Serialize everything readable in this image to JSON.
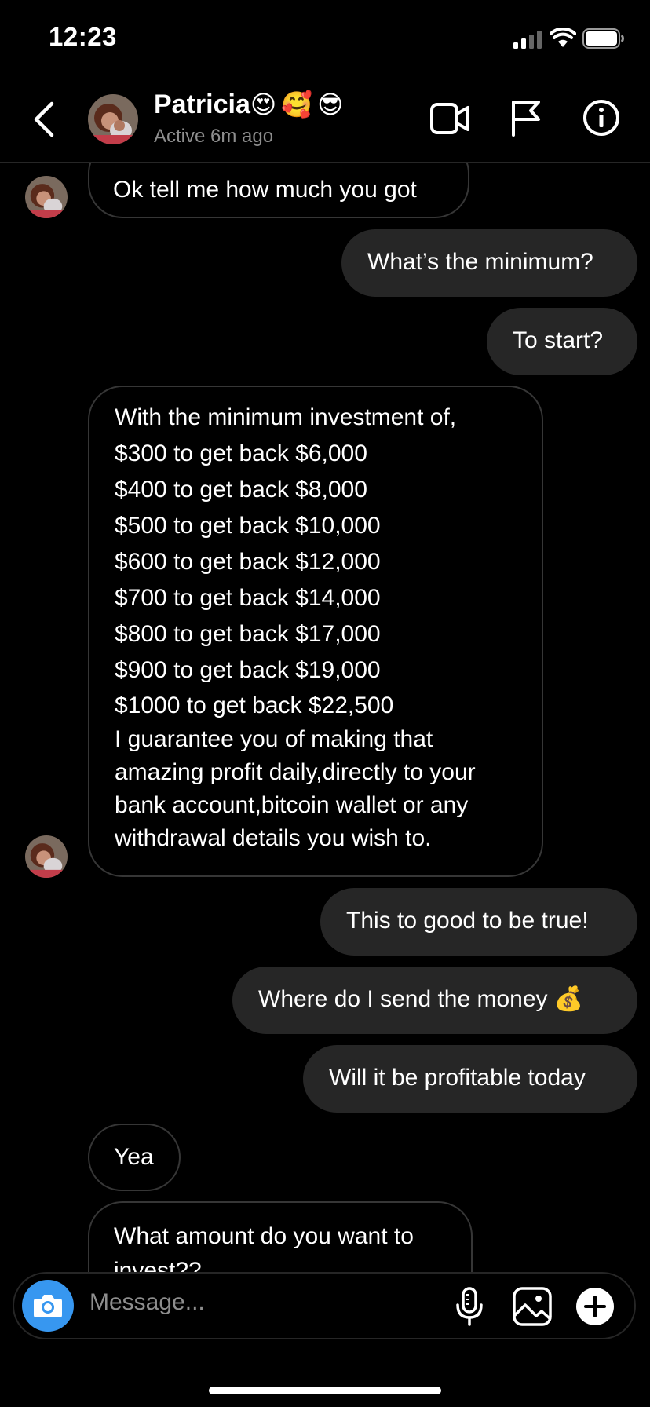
{
  "status_bar": {
    "time": "12:23"
  },
  "header": {
    "name": "Patricia",
    "name_emojis": [
      "😍",
      "🥰",
      "😎"
    ],
    "status": "Active 6m ago",
    "icons": [
      "back-icon",
      "video-call-icon",
      "flag-icon",
      "info-icon"
    ]
  },
  "messages": [
    {
      "dir": "in",
      "lines": [
        "Ok tell me how much you got"
      ]
    },
    {
      "dir": "out",
      "lines": [
        "What’s the minimum?"
      ]
    },
    {
      "dir": "out",
      "lines": [
        "To start?"
      ]
    },
    {
      "dir": "in",
      "lines": [
        "With the minimum investment of,",
        "$300 to get back $6,000",
        "$400 to get back $8,000",
        "$500 to get back $10,000",
        "$600 to get back $12,000",
        "$700 to get back $14,000",
        "$800 to get back $17,000",
        "$900 to get back $19,000",
        "$1000 to get back $22,500",
        "I guarantee you of making that",
        "amazing profit daily,directly to your",
        "bank account,bitcoin wallet or any",
        "withdrawal details you wish to."
      ]
    },
    {
      "dir": "out",
      "lines": [
        "This to good to be true!"
      ]
    },
    {
      "dir": "out",
      "lines": [
        "Where do I send the money 💰"
      ]
    },
    {
      "dir": "out",
      "lines": [
        "Will it be profitable today"
      ]
    },
    {
      "dir": "in",
      "lines": [
        "Yea"
      ]
    },
    {
      "dir": "in",
      "lines": [
        "What amount do you want to",
        "invest??"
      ]
    }
  ],
  "composer": {
    "placeholder": "Message...",
    "icons": [
      "camera-icon",
      "microphone-icon",
      "gallery-icon",
      "plus-icon"
    ]
  },
  "colors": {
    "accent": "#3797f0",
    "outgoing_bubble": "#262626",
    "incoming_border": "#363636"
  }
}
